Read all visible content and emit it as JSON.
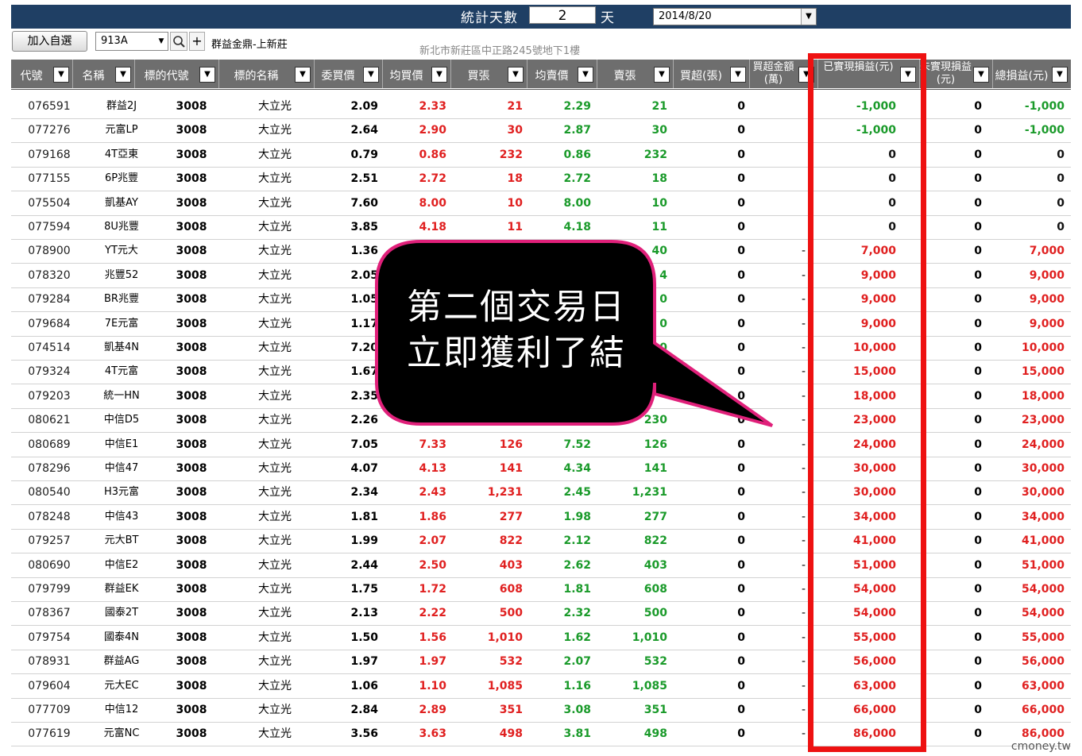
{
  "toolbar": {
    "stat_days_label": "統計天數",
    "stat_days_value": "2",
    "day_unit": "天",
    "date_value": "2014/8/20",
    "add_button": "加入自選",
    "code_value": "913A",
    "plus_label": "+",
    "broker_name": "群益金鼎-上新莊",
    "address": "新北市新莊區中正路245號地下1樓"
  },
  "columns": [
    "代號",
    "名稱",
    "標的代號",
    "標的名稱",
    "委買價",
    "均買價",
    "買張",
    "均賣價",
    "賣張",
    "買超(張)",
    "買超金額(萬)",
    "已實現損益(元)",
    "未實現損益(元)",
    "總損益(元)"
  ],
  "rows": [
    [
      "076591",
      "群益2J",
      "3008",
      "大立光",
      "2.09",
      "2.33",
      "21",
      "2.29",
      "21",
      "0",
      "",
      "-1,000",
      "0",
      "-1,000"
    ],
    [
      "077276",
      "元富LP",
      "3008",
      "大立光",
      "2.64",
      "2.90",
      "30",
      "2.87",
      "30",
      "0",
      "",
      "-1,000",
      "0",
      "-1,000"
    ],
    [
      "079168",
      "4T亞東",
      "3008",
      "大立光",
      "0.79",
      "0.86",
      "232",
      "0.86",
      "232",
      "0",
      "",
      "0",
      "0",
      "0"
    ],
    [
      "077155",
      "6P兆豐",
      "3008",
      "大立光",
      "2.51",
      "2.72",
      "18",
      "2.72",
      "18",
      "0",
      "",
      "0",
      "0",
      "0"
    ],
    [
      "075504",
      "凱基AY",
      "3008",
      "大立光",
      "7.60",
      "8.00",
      "10",
      "8.00",
      "10",
      "0",
      "",
      "0",
      "0",
      "0"
    ],
    [
      "077594",
      "8U兆豐",
      "3008",
      "大立光",
      "3.85",
      "4.18",
      "11",
      "4.18",
      "11",
      "0",
      "",
      "0",
      "0",
      "0"
    ],
    [
      "078900",
      "YT元大",
      "3008",
      "大立光",
      "1.36",
      "",
      "",
      "",
      "40",
      "0",
      "-",
      "7,000",
      "0",
      "7,000"
    ],
    [
      "078320",
      "兆豐52",
      "3008",
      "大立光",
      "2.05",
      "",
      "",
      "",
      "4",
      "0",
      "-",
      "9,000",
      "0",
      "9,000"
    ],
    [
      "079284",
      "BR兆豐",
      "3008",
      "大立光",
      "1.05",
      "",
      "",
      "",
      "0",
      "0",
      "-",
      "9,000",
      "0",
      "9,000"
    ],
    [
      "079684",
      "7E元富",
      "3008",
      "大立光",
      "1.17",
      "",
      "",
      "",
      "0",
      "0",
      "-",
      "9,000",
      "0",
      "9,000"
    ],
    [
      "074514",
      "凱基4N",
      "3008",
      "大立光",
      "7.20",
      "",
      "",
      "",
      "0",
      "0",
      "-",
      "10,000",
      "0",
      "10,000"
    ],
    [
      "079324",
      "4T元富",
      "3008",
      "大立光",
      "1.67",
      "",
      "",
      "",
      "",
      "0",
      "-",
      "15,000",
      "0",
      "15,000"
    ],
    [
      "079203",
      "統一HN",
      "3008",
      "大立光",
      "2.35",
      "",
      "",
      "",
      "",
      "0",
      "-",
      "18,000",
      "0",
      "18,000"
    ],
    [
      "080621",
      "中信D5",
      "3008",
      "大立光",
      "2.26",
      "",
      "",
      "",
      "230",
      "0",
      "-",
      "23,000",
      "0",
      "23,000"
    ],
    [
      "080689",
      "中信E1",
      "3008",
      "大立光",
      "7.05",
      "7.33",
      "126",
      "7.52",
      "126",
      "0",
      "-",
      "24,000",
      "0",
      "24,000"
    ],
    [
      "078296",
      "中信47",
      "3008",
      "大立光",
      "4.07",
      "4.13",
      "141",
      "4.34",
      "141",
      "0",
      "-",
      "30,000",
      "0",
      "30,000"
    ],
    [
      "080540",
      "H3元富",
      "3008",
      "大立光",
      "2.34",
      "2.43",
      "1,231",
      "2.45",
      "1,231",
      "0",
      "-",
      "30,000",
      "0",
      "30,000"
    ],
    [
      "078248",
      "中信43",
      "3008",
      "大立光",
      "1.81",
      "1.86",
      "277",
      "1.98",
      "277",
      "0",
      "-",
      "34,000",
      "0",
      "34,000"
    ],
    [
      "079257",
      "元大BT",
      "3008",
      "大立光",
      "1.99",
      "2.07",
      "822",
      "2.12",
      "822",
      "0",
      "-",
      "41,000",
      "0",
      "41,000"
    ],
    [
      "080690",
      "中信E2",
      "3008",
      "大立光",
      "2.44",
      "2.50",
      "403",
      "2.62",
      "403",
      "0",
      "-",
      "51,000",
      "0",
      "51,000"
    ],
    [
      "079799",
      "群益EK",
      "3008",
      "大立光",
      "1.75",
      "1.72",
      "608",
      "1.81",
      "608",
      "0",
      "-",
      "54,000",
      "0",
      "54,000"
    ],
    [
      "078367",
      "國泰2T",
      "3008",
      "大立光",
      "2.13",
      "2.22",
      "500",
      "2.32",
      "500",
      "0",
      "-",
      "54,000",
      "0",
      "54,000"
    ],
    [
      "079754",
      "國泰4N",
      "3008",
      "大立光",
      "1.50",
      "1.56",
      "1,010",
      "1.62",
      "1,010",
      "0",
      "-",
      "55,000",
      "0",
      "55,000"
    ],
    [
      "078931",
      "群益AG",
      "3008",
      "大立光",
      "1.97",
      "1.97",
      "532",
      "2.07",
      "532",
      "0",
      "-",
      "56,000",
      "0",
      "56,000"
    ],
    [
      "079604",
      "元大EC",
      "3008",
      "大立光",
      "1.06",
      "1.10",
      "1,085",
      "1.16",
      "1,085",
      "0",
      "-",
      "63,000",
      "0",
      "63,000"
    ],
    [
      "077709",
      "中信12",
      "3008",
      "大立光",
      "2.84",
      "2.89",
      "351",
      "3.08",
      "351",
      "0",
      "-",
      "66,000",
      "0",
      "66,000"
    ],
    [
      "077619",
      "元富NC",
      "3008",
      "大立光",
      "3.56",
      "3.63",
      "498",
      "3.81",
      "498",
      "0",
      "-",
      "86,000",
      "0",
      "86,000"
    ]
  ],
  "callout": {
    "line1": "第二個交易日",
    "line2": "立即獲利了結"
  },
  "watermark": "cmoney.tw",
  "colors": {
    "header_bar": "#1f3f64",
    "column_header": "#6e6e6e",
    "profit": "#e02020",
    "loss": "#1a9a2a",
    "highlight": "#ee1111",
    "callout_bg": "#000000",
    "callout_border": "#e0207a"
  }
}
